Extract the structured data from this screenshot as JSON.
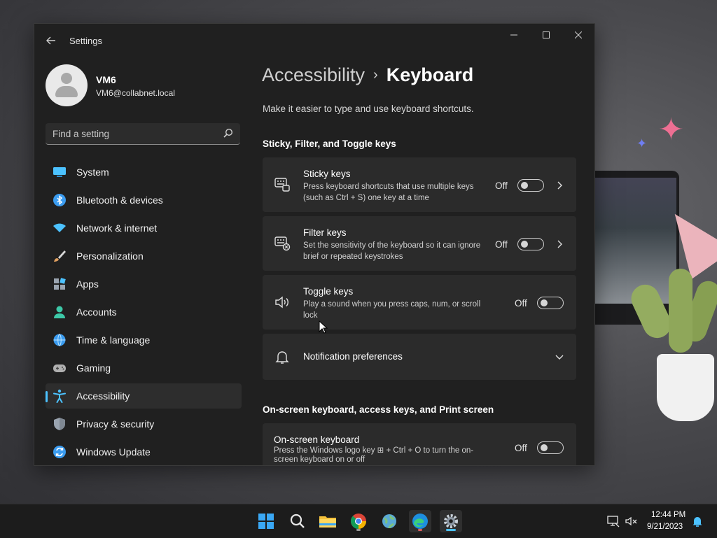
{
  "window": {
    "title": "Settings",
    "controls": {
      "minimize": "—",
      "maximize": "☐",
      "close": "✕"
    }
  },
  "user": {
    "name": "VM6",
    "email": "VM6@collabnet.local"
  },
  "search": {
    "placeholder": "Find a setting"
  },
  "sidebar": {
    "items": [
      {
        "label": "System",
        "icon": "system-icon",
        "color": "#4cc2ff"
      },
      {
        "label": "Bluetooth & devices",
        "icon": "bluetooth-icon",
        "color": "#3b9cf0"
      },
      {
        "label": "Network & internet",
        "icon": "wifi-icon",
        "color": "#4cc2ff"
      },
      {
        "label": "Personalization",
        "icon": "brush-icon",
        "color": "#e0a060"
      },
      {
        "label": "Apps",
        "icon": "apps-icon",
        "color": "#9aa4b0"
      },
      {
        "label": "Accounts",
        "icon": "accounts-icon",
        "color": "#3dc9a8"
      },
      {
        "label": "Time & language",
        "icon": "globe-clock-icon",
        "color": "#3b9cf0"
      },
      {
        "label": "Gaming",
        "icon": "gamepad-icon",
        "color": "#b0b0b0"
      },
      {
        "label": "Accessibility",
        "icon": "accessibility-icon",
        "color": "#4cc2ff",
        "active": true
      },
      {
        "label": "Privacy & security",
        "icon": "shield-icon",
        "color": "#9aa4b0"
      },
      {
        "label": "Windows Update",
        "icon": "update-icon",
        "color": "#3b9cf0"
      }
    ]
  },
  "breadcrumb": {
    "parent": "Accessibility",
    "separator": "›",
    "current": "Keyboard"
  },
  "subtitle": "Make it easier to type and use keyboard shortcuts.",
  "sections": {
    "sticky_filter_toggle": "Sticky, Filter, and Toggle keys",
    "onscreen": "On-screen keyboard, access keys, and Print screen"
  },
  "cards": {
    "sticky": {
      "title": "Sticky keys",
      "desc": "Press keyboard shortcuts that use multiple keys (such as Ctrl + S) one key at a time",
      "state": "Off",
      "icon": "sticky-keys-icon"
    },
    "filter": {
      "title": "Filter keys",
      "desc": "Set the sensitivity of the keyboard so it can ignore brief or repeated keystrokes",
      "state": "Off",
      "icon": "filter-keys-icon"
    },
    "toggle": {
      "title": "Toggle keys",
      "desc": "Play a sound when you press caps, num, or scroll lock",
      "state": "Off",
      "icon": "speaker-icon"
    },
    "notification": {
      "title": "Notification preferences",
      "icon": "bell-icon"
    },
    "onscreen": {
      "title": "On-screen keyboard",
      "desc": "Press the Windows logo key ⊞ + Ctrl + O to turn the on-screen keyboard on or off",
      "state": "Off"
    }
  },
  "taskbar": {
    "apps": [
      {
        "name": "start-icon"
      },
      {
        "name": "search-icon"
      },
      {
        "name": "file-explorer-icon"
      },
      {
        "name": "chrome-icon"
      },
      {
        "name": "network-globe-icon"
      },
      {
        "name": "edge-icon"
      },
      {
        "name": "settings-icon",
        "active": true
      }
    ],
    "time": "12:44 PM",
    "date": "9/21/2023"
  },
  "colors": {
    "accent": "#4cc2ff",
    "window_bg": "#202020",
    "card_bg": "#2b2b2b"
  }
}
